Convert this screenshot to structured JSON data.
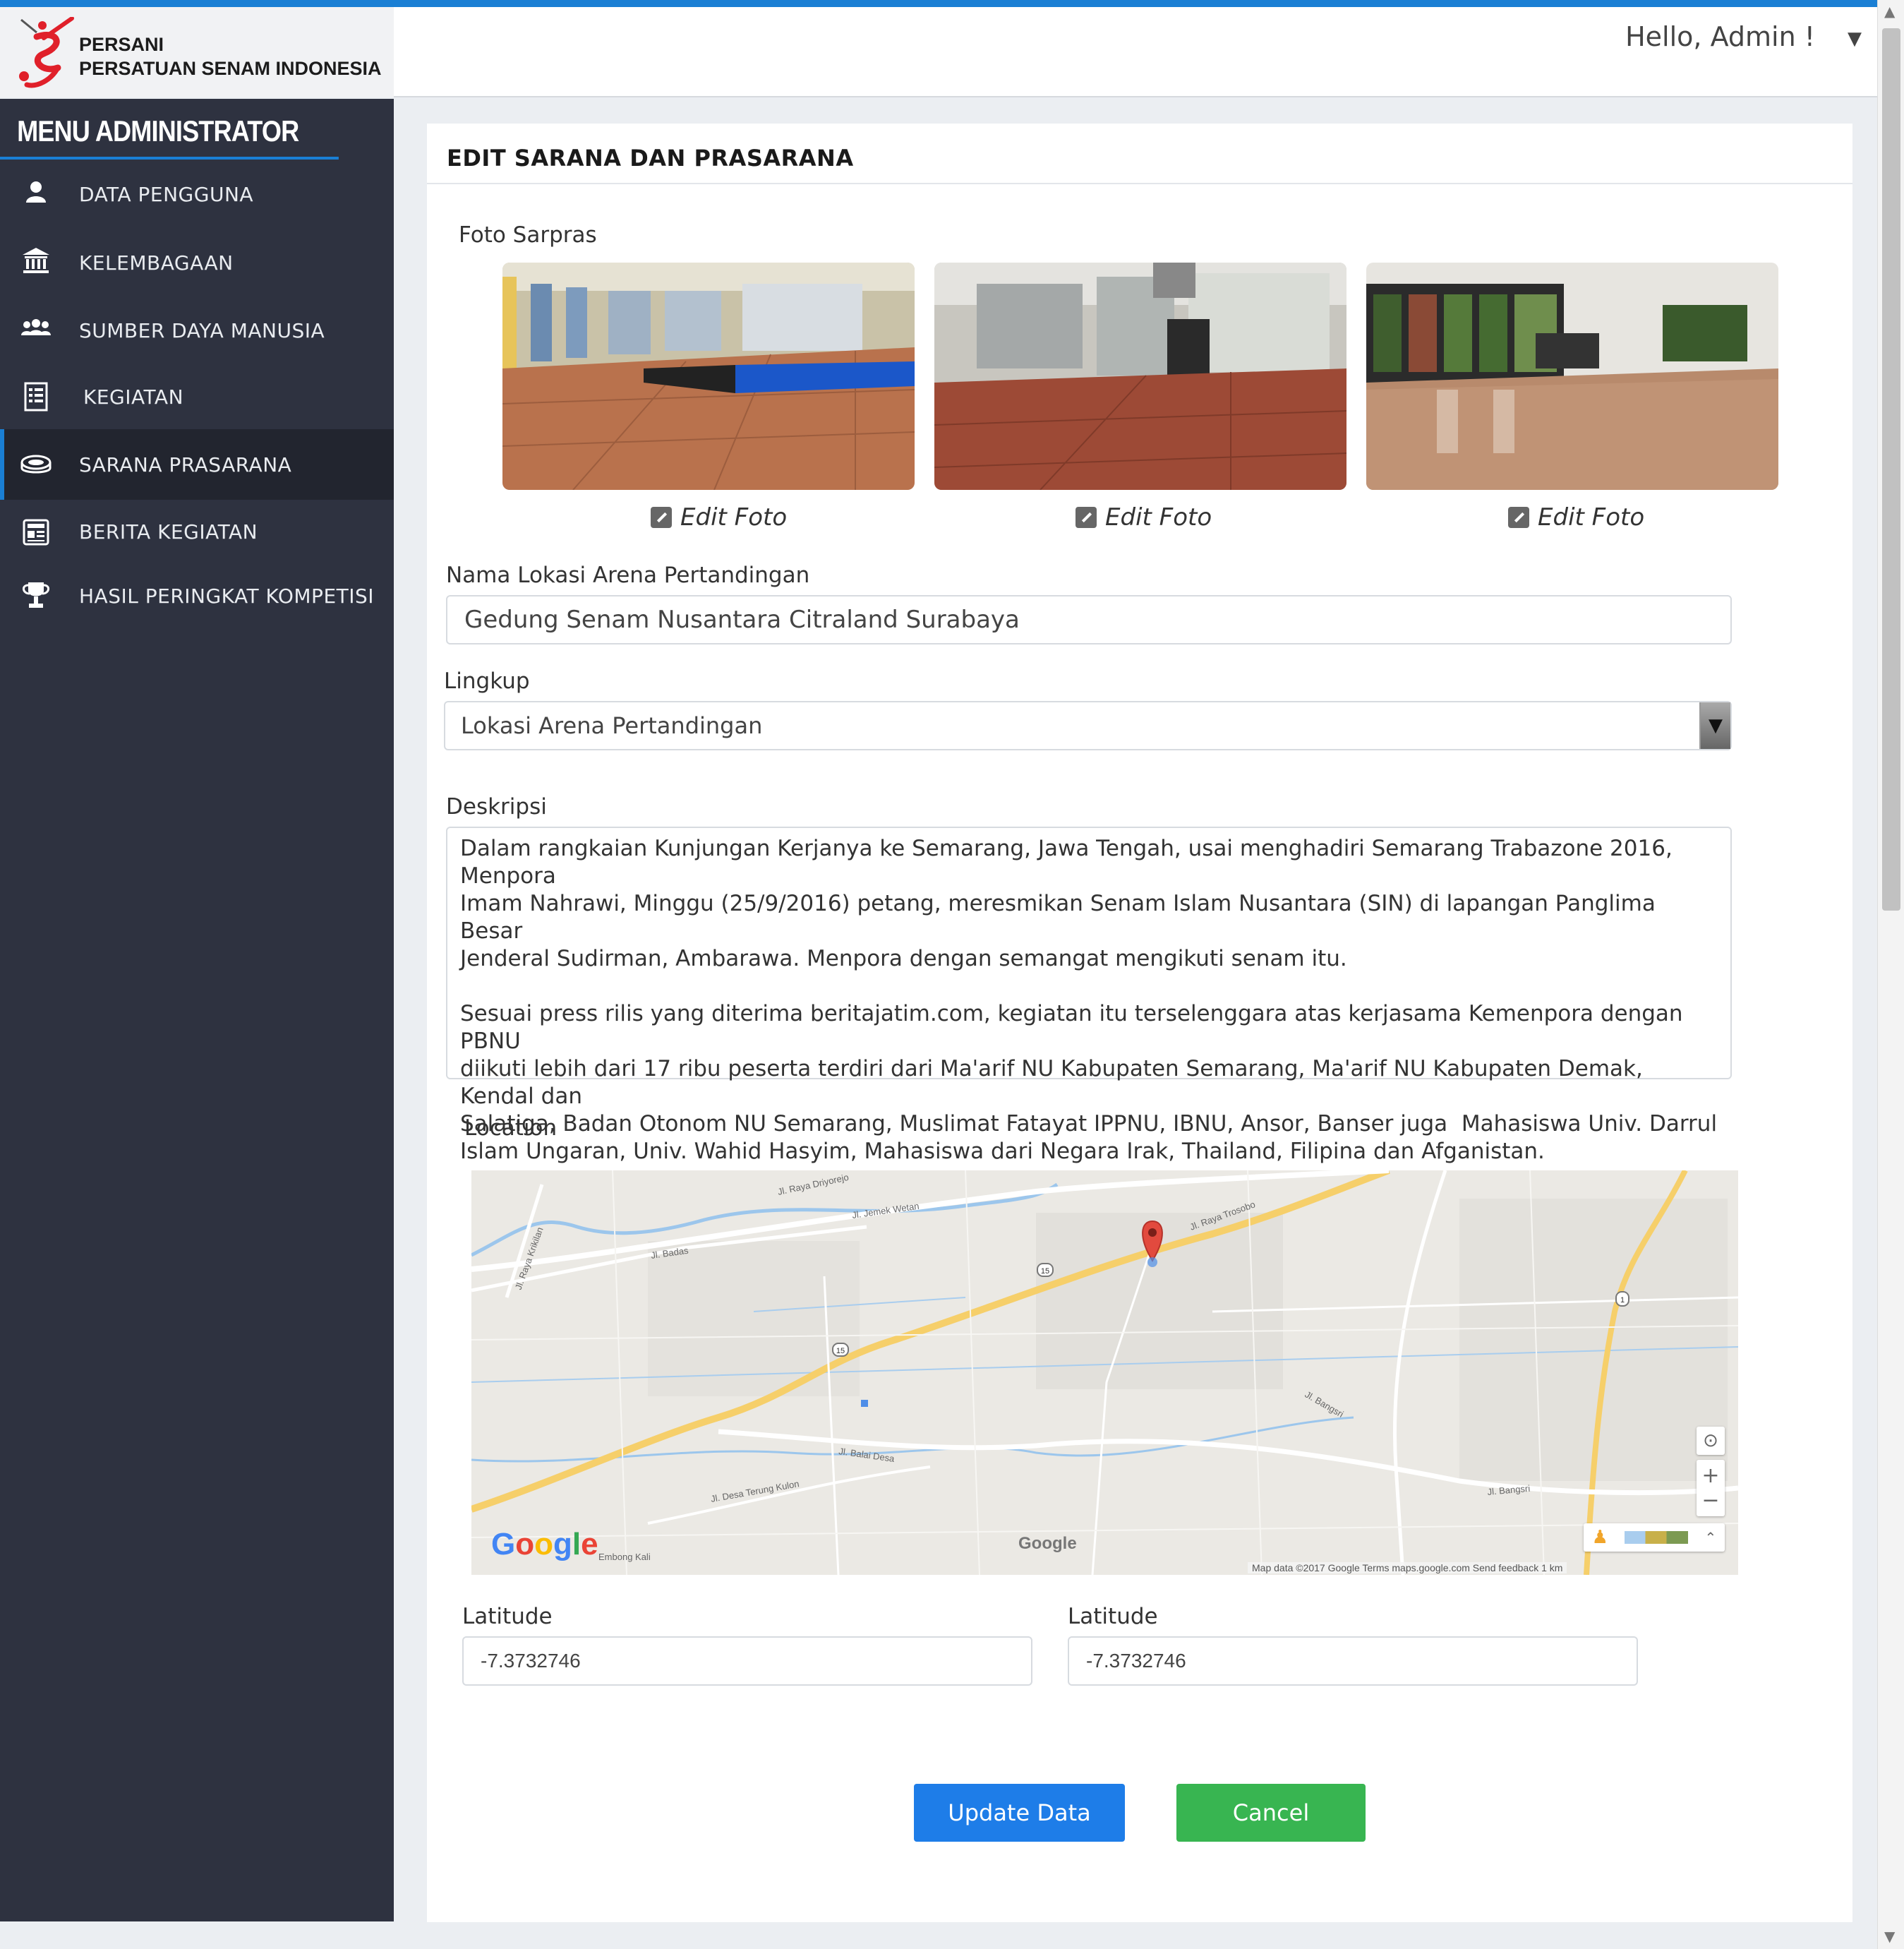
{
  "header": {
    "brand_short": "PERSANI",
    "brand_full": "PERSATUAN SENAM INDONESIA",
    "greeting": "Hello, Admin !"
  },
  "sidebar": {
    "title": "MENU ADMINISTRATOR",
    "items": [
      {
        "label": "DATA PENGGUNA",
        "icon": "user-icon"
      },
      {
        "label": "KELEMBAGAAN",
        "icon": "institution-icon"
      },
      {
        "label": "SUMBER DAYA MANUSIA",
        "icon": "group-icon"
      },
      {
        "label": "KEGIATAN",
        "icon": "document-list-icon"
      },
      {
        "label": "SARANA PRASARANA",
        "icon": "stadium-icon",
        "active": true
      },
      {
        "label": "BERITA KEGIATAN",
        "icon": "news-icon"
      },
      {
        "label": "HASIL PERINGKAT KOMPETISI",
        "icon": "trophy-icon"
      }
    ]
  },
  "form": {
    "title": "EDIT SARANA DAN PRASARANA",
    "photos_label": "Foto Sarpras",
    "edit_photo_label": "Edit Foto",
    "name_label": "Nama Lokasi Arena Pertandingan",
    "name_value": "Gedung Senam Nusantara Citraland Surabaya",
    "scope_label": "Lingkup",
    "scope_value": "Lokasi Arena Pertandingan",
    "description_label": "Deskripsi",
    "description_value": "Dalam rangkaian Kunjungan Kerjanya ke Semarang, Jawa Tengah, usai menghadiri Semarang Trabazone 2016, Menpora\nImam Nahrawi, Minggu (25/9/2016) petang, meresmikan Senam Islam Nusantara (SIN) di lapangan Panglima Besar\nJenderal Sudirman, Ambarawa. Menpora dengan semangat mengikuti senam itu.\n\nSesuai press rilis yang diterima beritajatim.com, kegiatan itu terselenggara atas kerjasama Kemenpora dengan PBNU\ndiikuti lebih dari 17 ribu peserta terdiri dari Ma'arif NU Kabupaten Semarang, Ma'arif NU Kabupaten Demak, Kendal dan\nSalatiga, Badan Otonom NU Semarang, Muslimat Fatayat IPPNU, IBNU, Ansor, Banser juga  Mahasiswa Univ. Darrul\nIslam Ungaran, Univ. Wahid Hasyim, Mahasiswa dari Negara Irak, Thailand, Filipina dan Afganistan.",
    "location_label": "Location",
    "lat_label_1": "Latitude",
    "lat_value_1": "-7.3732746",
    "lat_label_2": "Latitude",
    "lat_value_2": "-7.3732746",
    "update_button": "Update Data",
    "cancel_button": "Cancel"
  },
  "map": {
    "streets": [
      "Jl. Raya Driyorejo",
      "Jl. Jemek Wetan",
      "Jl. Badas",
      "Jl. Raya Krikilan",
      "Jl. Raya Trosobo",
      "Jl. Bangsri",
      "Jl. Balai Desa",
      "Jl. Desa Terung Kulon",
      "Embong Kali"
    ],
    "route_badges": [
      "15",
      "15",
      "1"
    ],
    "footer": "Map data ©2017 Google   Terms   maps.google.com   Send feedback   1 km",
    "logo": "Google",
    "colors": {
      "road_major": "#f6cf6a",
      "river": "#9cc6ec",
      "marker": "#e24a3e"
    }
  }
}
